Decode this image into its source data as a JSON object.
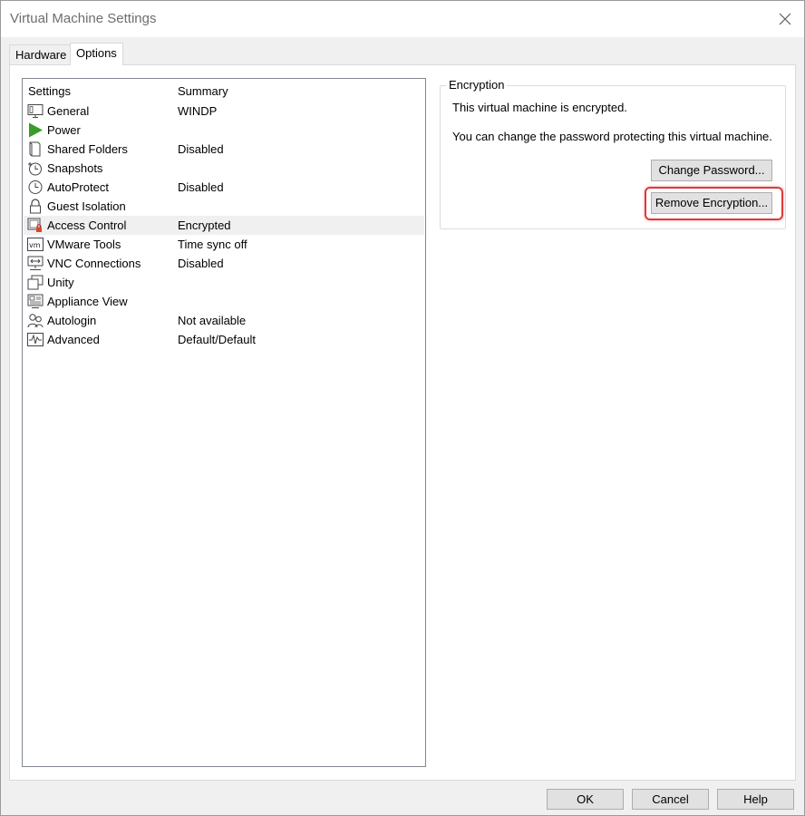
{
  "window": {
    "title": "Virtual Machine Settings",
    "close_icon": "close-icon"
  },
  "tabs": [
    {
      "label": "Hardware",
      "active": false
    },
    {
      "label": "Options",
      "active": true
    }
  ],
  "settings_list": {
    "header_settings": "Settings",
    "header_summary": "Summary",
    "items": [
      {
        "name": "General",
        "summary": "WINDP",
        "icon": "monitor-icon"
      },
      {
        "name": "Power",
        "summary": "",
        "icon": "play-icon"
      },
      {
        "name": "Shared Folders",
        "summary": "Disabled",
        "icon": "folder-icon"
      },
      {
        "name": "Snapshots",
        "summary": "",
        "icon": "snapshot-clock-icon"
      },
      {
        "name": "AutoProtect",
        "summary": "Disabled",
        "icon": "clock-icon"
      },
      {
        "name": "Guest Isolation",
        "summary": "",
        "icon": "lock-icon"
      },
      {
        "name": "Access Control",
        "summary": "Encrypted",
        "icon": "access-lock-icon",
        "selected": true
      },
      {
        "name": "VMware Tools",
        "summary": "Time sync off",
        "icon": "vm-icon"
      },
      {
        "name": "VNC Connections",
        "summary": "Disabled",
        "icon": "network-icon"
      },
      {
        "name": "Unity",
        "summary": "",
        "icon": "windows-icon"
      },
      {
        "name": "Appliance View",
        "summary": "",
        "icon": "appliance-icon"
      },
      {
        "name": "Autologin",
        "summary": "Not available",
        "icon": "users-icon"
      },
      {
        "name": "Advanced",
        "summary": "Default/Default",
        "icon": "pulse-icon"
      }
    ]
  },
  "encryption": {
    "legend": "Encryption",
    "status_text": "This virtual machine is encrypted.",
    "info_text": "You can change the password protecting this virtual machine.",
    "change_password_label": "Change Password...",
    "remove_encryption_label": "Remove Encryption...",
    "highlight_color": "#e0383b"
  },
  "footer": {
    "ok_label": "OK",
    "cancel_label": "Cancel",
    "help_label": "Help"
  }
}
